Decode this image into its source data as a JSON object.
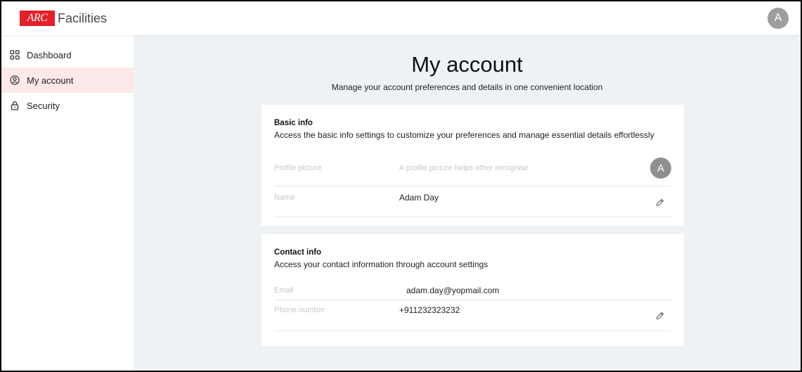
{
  "brand": {
    "logo_mark": "ARC",
    "name": "Facilities",
    "accent_color": "#e4202b"
  },
  "header": {
    "avatar_initial": "A"
  },
  "sidebar": {
    "items": [
      {
        "label": "Dashboard",
        "icon": "grid-icon",
        "active": false
      },
      {
        "label": "My account",
        "icon": "user-circle-icon",
        "active": true
      },
      {
        "label": "Security",
        "icon": "lock-icon",
        "active": false
      }
    ],
    "active_color": "#fde8ea"
  },
  "main": {
    "title": "My account",
    "subtitle": "Manage your account preferences and details in one convenient location"
  },
  "basic_info": {
    "title": "Basic info",
    "description": "Access the basic info settings to customize your preferences and manage essential details effortlessly",
    "profile_picture_label": "Profile picture",
    "profile_picture_hint": "A profile picture helps other recognise",
    "avatar_initial": "A",
    "name_label": "Name",
    "name_value": "Adam Day"
  },
  "contact_info": {
    "title": "Contact info",
    "description": "Access your contact information through account settings",
    "email_label": "Email",
    "email_value": "adam.day@yopmail.com",
    "phone_label": "Phone number",
    "phone_value": "+911232323232"
  }
}
